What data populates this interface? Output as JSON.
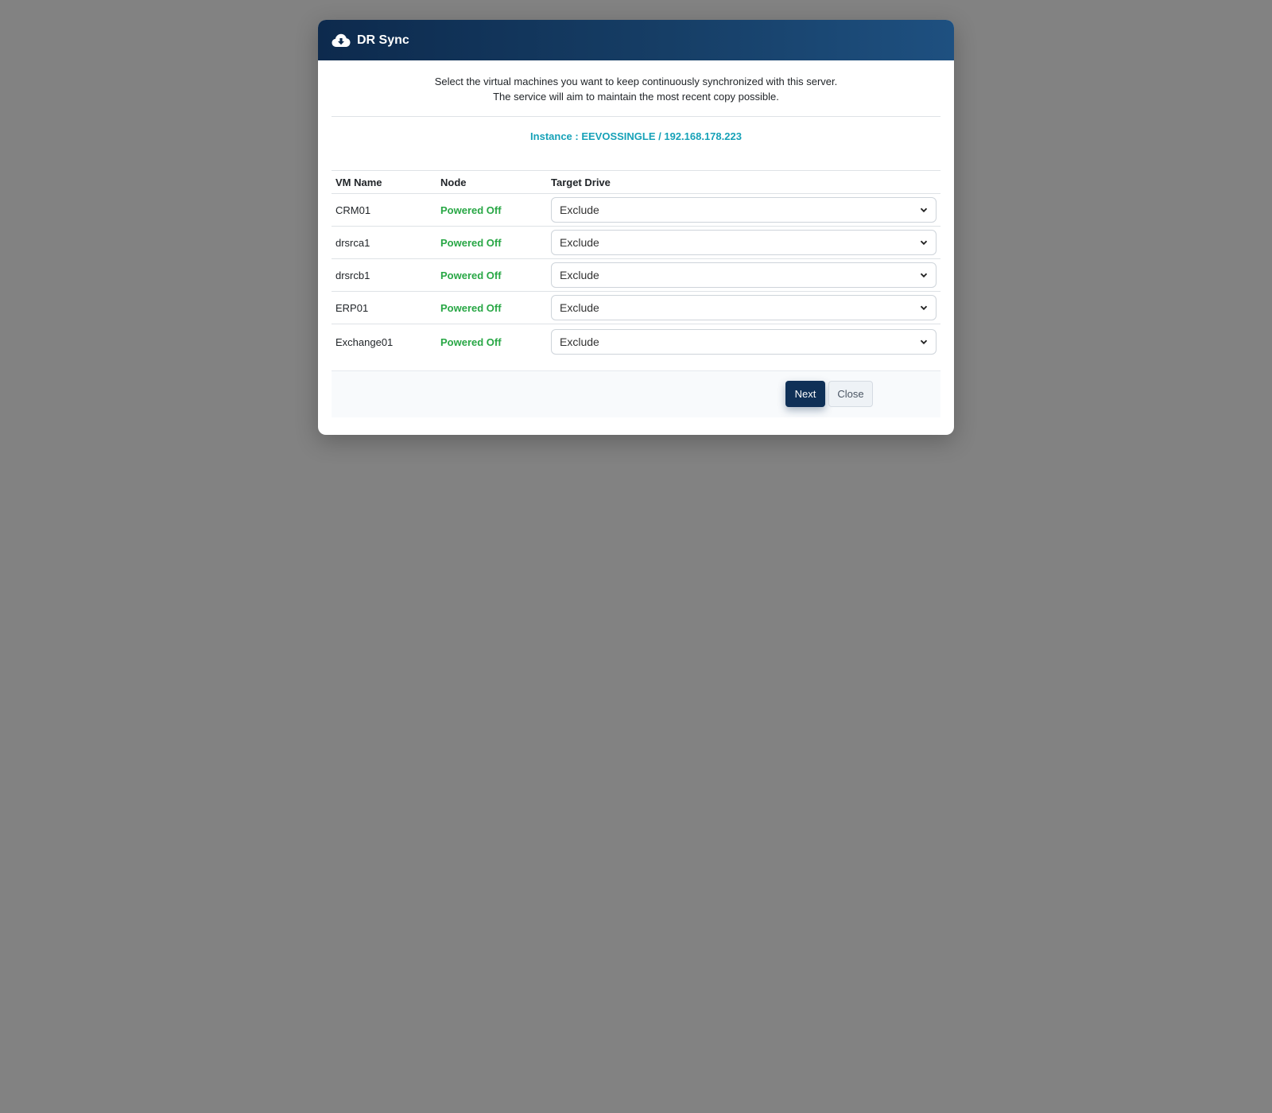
{
  "modal": {
    "title": "DR Sync",
    "icon": "cloud-download-icon",
    "intro_line1": "Select the virtual machines you want to keep continuously synchronized with this server.",
    "intro_line2": "The service will aim to maintain the most recent copy possible.",
    "instance": "Instance : EEVOSSINGLE / 192.168.178.223"
  },
  "table": {
    "headers": [
      "VM Name",
      "Node",
      "Target Drive"
    ],
    "rows": [
      {
        "name": "CRM01",
        "node": "Powered Off",
        "drive": "Exclude"
      },
      {
        "name": "drsrca1",
        "node": "Powered Off",
        "drive": "Exclude"
      },
      {
        "name": "drsrcb1",
        "node": "Powered Off",
        "drive": "Exclude"
      },
      {
        "name": "ERP01",
        "node": "Powered Off",
        "drive": "Exclude"
      },
      {
        "name": "Exchange01",
        "node": "Powered Off",
        "drive": "Exclude"
      }
    ]
  },
  "footer": {
    "next_label": "Next",
    "close_label": "Close"
  },
  "colors": {
    "header_dark": "#0d2a4d",
    "header_light": "#1e5080",
    "instance": "#17a2b8",
    "status": "#28a745",
    "next_button": "#0f3057",
    "overlay": "#828282"
  }
}
